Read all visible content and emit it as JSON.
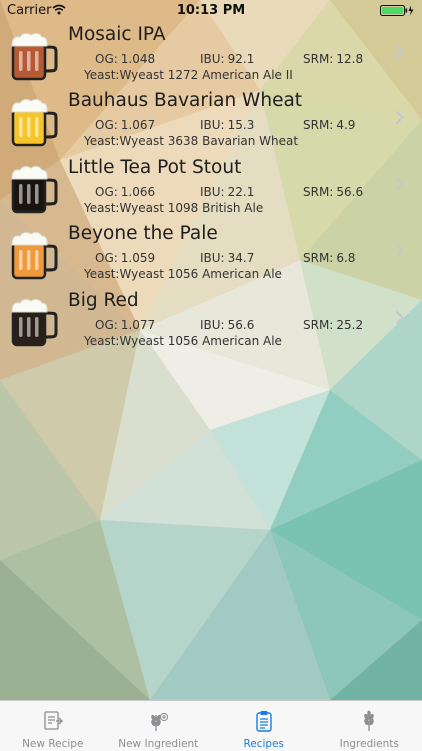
{
  "status_bar": {
    "carrier": "Carrier",
    "time": "10:13 PM",
    "battery_color": "#4cd964"
  },
  "recipes": [
    {
      "name": "Mosaic IPA",
      "og_label": "OG:",
      "og": "1.048",
      "ibu_label": "IBU:",
      "ibu": "92.1",
      "srm_label": "SRM:",
      "srm": "12.8",
      "yeast": "Yeast:Wyeast 1272 American Ale II",
      "beer_color": "#b55a35",
      "icon": "beer-mug-icon"
    },
    {
      "name": "Bauhaus Bavarian Wheat",
      "og_label": "OG:",
      "og": "1.067",
      "ibu_label": "IBU:",
      "ibu": "15.3",
      "srm_label": "SRM:",
      "srm": "4.9",
      "yeast": "Yeast:Wyeast 3638 Bavarian Wheat",
      "beer_color": "#f5c52a",
      "icon": "beer-mug-icon"
    },
    {
      "name": "Little Tea Pot Stout",
      "og_label": "OG:",
      "og": "1.066",
      "ibu_label": "IBU:",
      "ibu": "22.1",
      "srm_label": "SRM:",
      "srm": "56.6",
      "yeast": "Yeast:Wyeast 1098 British Ale",
      "beer_color": "#1a1410",
      "icon": "beer-mug-icon"
    },
    {
      "name": "Beyone the Pale",
      "og_label": "OG:",
      "og": "1.059",
      "ibu_label": "IBU:",
      "ibu": "34.7",
      "srm_label": "SRM:",
      "srm": "6.8",
      "yeast": "Yeast:Wyeast 1056 American Ale",
      "beer_color": "#ee9a3c",
      "icon": "beer-mug-icon"
    },
    {
      "name": "Big Red",
      "og_label": "OG:",
      "og": "1.077",
      "ibu_label": "IBU:",
      "ibu": "56.6",
      "srm_label": "SRM:",
      "srm": "25.2",
      "yeast": "Yeast:Wyeast 1056 American Ale",
      "beer_color": "#2a1f18",
      "icon": "beer-mug-icon"
    }
  ],
  "tabs": [
    {
      "label": "New Recipe",
      "icon": "new-recipe-icon",
      "active": false
    },
    {
      "label": "New Ingredient",
      "icon": "wheat-plus-icon",
      "active": false
    },
    {
      "label": "Recipes",
      "icon": "clipboard-icon",
      "active": true
    },
    {
      "label": "Ingredients",
      "icon": "wheat-icon",
      "active": false
    }
  ],
  "colors": {
    "tab_active": "#1a7de0",
    "tab_inactive": "#8e8e93",
    "tabbar_bg": "#f7f7f7"
  }
}
